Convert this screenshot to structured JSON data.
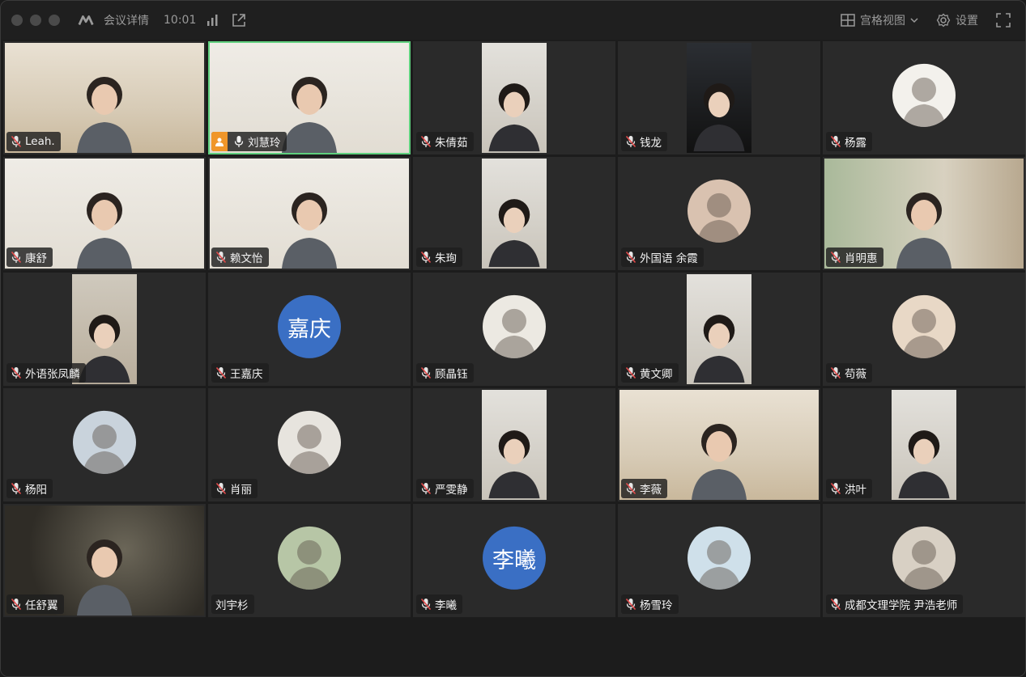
{
  "titlebar": {
    "app_name": "会议详情",
    "time": "10:01",
    "view_mode": "宫格视图",
    "settings_label": "设置"
  },
  "participants": [
    {
      "name": "Leah.",
      "muted": true,
      "type": "video"
    },
    {
      "name": "刘慧玲",
      "muted": false,
      "type": "video",
      "host": true,
      "speaking": true
    },
    {
      "name": "朱倩茹",
      "muted": true,
      "type": "video-portrait"
    },
    {
      "name": "钱龙",
      "muted": true,
      "type": "video-portrait"
    },
    {
      "name": "杨露",
      "muted": true,
      "type": "avatar-image"
    },
    {
      "name": "康舒",
      "muted": true,
      "type": "video"
    },
    {
      "name": "赖文怡",
      "muted": true,
      "type": "video"
    },
    {
      "name": "朱珣",
      "muted": true,
      "type": "video-portrait"
    },
    {
      "name": "外国语 余霞",
      "muted": true,
      "type": "avatar-image"
    },
    {
      "name": "肖明惠",
      "muted": true,
      "type": "video"
    },
    {
      "name": "外语张凤麟",
      "muted": true,
      "type": "video-portrait"
    },
    {
      "name": "王嘉庆",
      "muted": true,
      "type": "avatar-text",
      "avatar_text": "嘉庆"
    },
    {
      "name": "顾晶钰",
      "muted": true,
      "type": "avatar-image"
    },
    {
      "name": "黄文卿",
      "muted": true,
      "type": "video-portrait"
    },
    {
      "name": "苟薇",
      "muted": true,
      "type": "avatar-image"
    },
    {
      "name": "杨阳",
      "muted": true,
      "type": "avatar-image"
    },
    {
      "name": "肖丽",
      "muted": true,
      "type": "avatar-image"
    },
    {
      "name": "严雯静",
      "muted": true,
      "type": "video-portrait"
    },
    {
      "name": "李薇",
      "muted": true,
      "type": "video"
    },
    {
      "name": "洪叶",
      "muted": true,
      "type": "video-portrait"
    },
    {
      "name": "任舒翼",
      "muted": true,
      "type": "video"
    },
    {
      "name": "刘宇杉",
      "muted": false,
      "type": "avatar-image",
      "no_mic": true
    },
    {
      "name": "李曦",
      "muted": true,
      "type": "avatar-text",
      "avatar_text": "李曦"
    },
    {
      "name": "杨雪玲",
      "muted": true,
      "type": "avatar-image"
    },
    {
      "name": "成都文理学院 尹浩老师",
      "muted": true,
      "type": "avatar-image"
    }
  ],
  "colors": {
    "active_border": "#5fd07e",
    "avatar_blue": "#3a6fc4",
    "host_badge": "#f0962a"
  }
}
